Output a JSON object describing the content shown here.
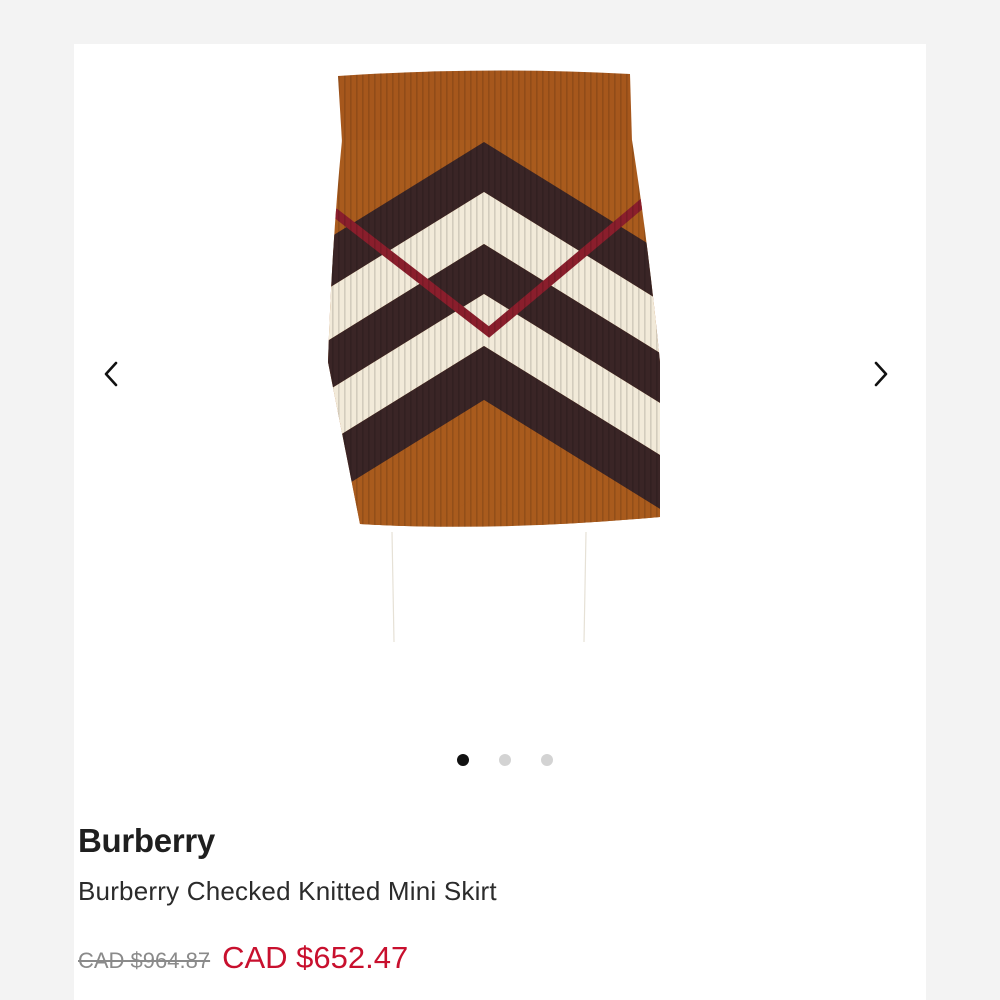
{
  "carousel": {
    "prev_icon": "chevron-left-icon",
    "next_icon": "chevron-right-icon",
    "slide_count": 3,
    "active_slide": 1
  },
  "product": {
    "brand": "Burberry",
    "name": "Burberry Checked Knitted Mini Skirt",
    "original_price": "CAD $964.87",
    "sale_price": "CAD $652.47"
  },
  "colors": {
    "sale_price": "#c8102e",
    "active_dot": "#111111",
    "inactive_dot": "#d3d3d3"
  }
}
